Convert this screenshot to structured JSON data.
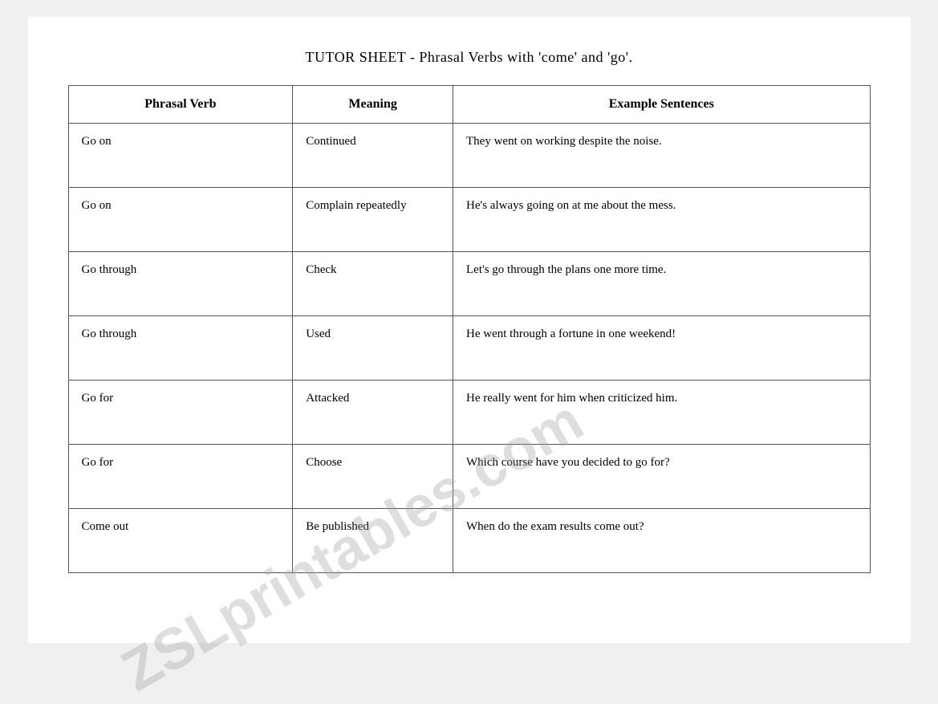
{
  "page": {
    "title": "TUTOR SHEET - Phrasal Verbs with 'come' and 'go'.",
    "watermark": "ZSLprintables.com",
    "table": {
      "headers": [
        "Phrasal Verb",
        "Meaning",
        "Example Sentences"
      ],
      "rows": [
        {
          "phrasal_verb": "Go on",
          "meaning": "Continued",
          "example": "They went on working despite the noise."
        },
        {
          "phrasal_verb": "Go on",
          "meaning": "Complain repeatedly",
          "example": "He's always going on at me about the mess."
        },
        {
          "phrasal_verb": "Go through",
          "meaning": "Check",
          "example": "Let's go through the plans one more time."
        },
        {
          "phrasal_verb": "Go through",
          "meaning": "Used",
          "example": "He went through a fortune in one weekend!"
        },
        {
          "phrasal_verb": "Go for",
          "meaning": "Attacked",
          "example": "He really went for him when criticized him."
        },
        {
          "phrasal_verb": "Go for",
          "meaning": "Choose",
          "example": "Which course have you decided to go for?"
        },
        {
          "phrasal_verb": "Come out",
          "meaning": "Be published",
          "example": "When do the exam results come out?"
        }
      ]
    }
  }
}
